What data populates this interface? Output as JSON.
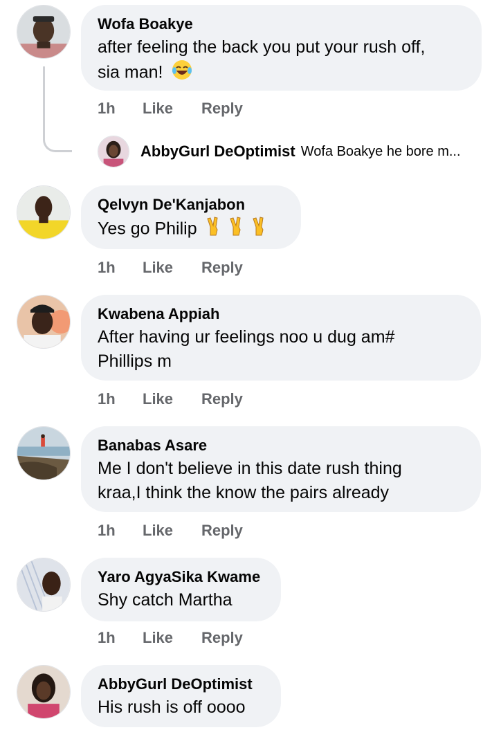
{
  "comments": [
    {
      "author": "Wofa Boakye",
      "line1": "after feeling the back you put your rush off,",
      "line2": "sia man!",
      "emoji": "laughing-crying-emoji",
      "time": "1h",
      "like": "Like",
      "reply": "Reply"
    },
    {
      "author": "Qelvyn De'Kanjabon",
      "line1": "Yes go Philip",
      "emoji": "victory-hand-emoji",
      "time": "1h",
      "like": "Like",
      "reply": "Reply"
    },
    {
      "author": "Kwabena Appiah",
      "line1": "After having ur feelings noo u dug am#",
      "line2": "Phillips m",
      "time": "1h",
      "like": "Like",
      "reply": "Reply"
    },
    {
      "author": "Banabas Asare",
      "line1": "Me I don't believe in this date rush thing",
      "line2": "kraa,I think the know the pairs already",
      "time": "1h",
      "like": "Like",
      "reply": "Reply"
    },
    {
      "author": "Yaro AgyaSika Kwame",
      "line1": "Shy catch Martha",
      "time": "1h",
      "like": "Like",
      "reply": "Reply"
    },
    {
      "author": "AbbyGurl DeOptimist",
      "line1": "His rush is off oooo"
    }
  ],
  "reply_preview": {
    "author": "AbbyGurl DeOptimist",
    "text": "Wofa Boakye he bore m..."
  },
  "colors": {
    "bubble": "#f0f2f5",
    "meta_text": "#65676b",
    "thread_line": "#ced0d4"
  }
}
